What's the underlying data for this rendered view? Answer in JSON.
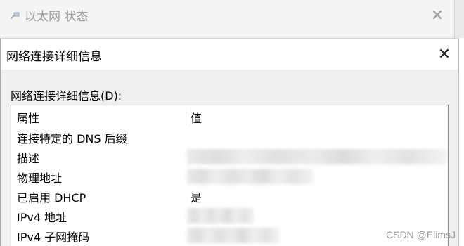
{
  "background_window": {
    "title": "以太网 状态",
    "close_glyph": "✕",
    "icon": "network-icon"
  },
  "dialog": {
    "title": "网络连接详细信息",
    "close_glyph": "✕",
    "section_label": "网络连接详细信息(D):",
    "columns": {
      "property": "属性",
      "value": "值"
    },
    "rows": [
      {
        "property": "连接特定的 DNS 后缀",
        "value": ""
      },
      {
        "property": "描述",
        "value": ""
      },
      {
        "property": "物理地址",
        "value": ""
      },
      {
        "property": "已启用 DHCP",
        "value": "是"
      },
      {
        "property": "IPv4 地址",
        "value": ""
      },
      {
        "property": "IPv4 子网掩码",
        "value": ""
      }
    ]
  },
  "watermark": "CSDN @ElimsJ"
}
